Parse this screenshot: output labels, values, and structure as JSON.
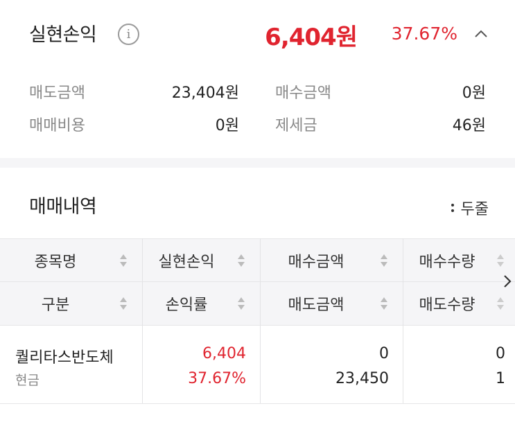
{
  "summary": {
    "title": "실현손익",
    "info_icon": "info-icon",
    "total_amount": "6,404원",
    "total_rate": "37.67%",
    "collapse_icon": "chevron-up-icon",
    "rows": [
      {
        "label": "매도금액",
        "value": "23,404원",
        "label2": "매수금액",
        "value2": "0원"
      },
      {
        "label": "매매비용",
        "value": "0원",
        "label2": "제세금",
        "value2": "46원"
      }
    ]
  },
  "history": {
    "title": "매매내역",
    "toggle_label": "두줄",
    "header_row1": [
      "종목명",
      "실현손익",
      "매수금액",
      "매수수량"
    ],
    "header_row2": [
      "구분",
      "손익률",
      "매도금액",
      "매도수량"
    ],
    "rows": [
      {
        "name": "퀄리타스반도체",
        "type": "현금",
        "profit": "6,404",
        "rate": "37.67%",
        "buy_amount": "0",
        "sell_amount": "23,450",
        "buy_qty": "0",
        "sell_qty": "1"
      }
    ]
  },
  "colors": {
    "accent_red": "#e0242f",
    "label_gray": "#888888",
    "header_bg": "#f5f5f7"
  }
}
